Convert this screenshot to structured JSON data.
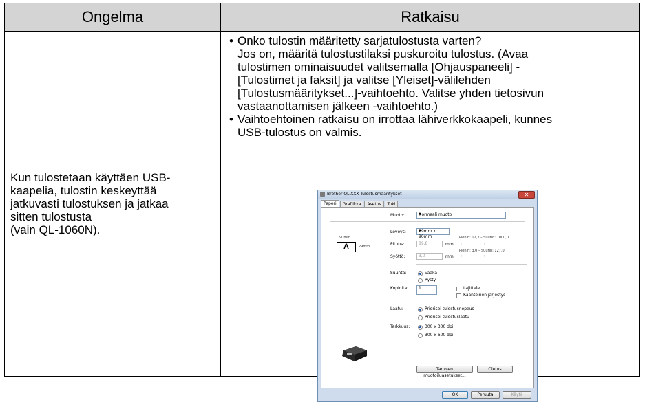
{
  "table": {
    "header_problem": "Ongelma",
    "header_solution": "Ratkaisu",
    "problem_lines": [
      "Kun tulostetaan käyttäen USB-",
      "kaapelia, tulostin keskeyttää",
      "jatkuvasti tulostuksen ja jatkaa",
      "sitten tulostusta",
      "(vain QL-1060N)."
    ],
    "bullet_symbol": "•",
    "bullet1_lines": [
      "Onko tulostin määritetty sarjatulostusta varten?",
      "Jos on, määritä tulostustilaksi puskuroitu tulostus. (Avaa",
      "tulostimen ominaisuudet valitsemalla [Ohjauspaneeli] -",
      "[Tulostimet ja faksit] ja valitse [Yleiset]-välilehden",
      "[Tulostusmääritykset...]-vaihtoehto. Valitse yhden tietosivun",
      "vastaanottamisen jälkeen -vaihtoehto.)"
    ],
    "bullet2_lines": [
      "Vaihtoehtoinen ratkaisu on irrottaa lähiverkkokaapeli, kunnes",
      "USB-tulostus on valmis."
    ]
  },
  "dialog": {
    "title": "Brother QL-XXX Tulostusmääritykset",
    "close": "✕",
    "tabs": [
      "Paperi",
      "Grafiikka",
      "Asetus",
      "Tuki"
    ],
    "muoto_label": "Muoto:",
    "muoto_value": "Normaali muoto",
    "leveys_label": "Leveys:",
    "leveys_value": "29mm x 90mm",
    "pituus_label": "Pituus:",
    "pituus_value": "89,8",
    "pituus_unit": "mm",
    "pituus_hint": "Pienin: 12,7 – Suurin: 1000,0",
    "syotto_label": "Syöttö:",
    "syotto_value": "3,0",
    "syotto_unit": "mm",
    "syotto_hint": "Pienin: 3,0 – Suurin: 127,0",
    "label_preview_w": "90mm",
    "label_preview_h": "29mm",
    "label_preview_letter": "A",
    "suunta_label": "Suunta:",
    "suunta_opt1": "Vaaka",
    "suunta_opt2": "Pysty",
    "kopioita_label": "Kopioita:",
    "kopioita_value": "1",
    "lajittele": "Lajittele",
    "kaanteinen": "Käänteinen järjestys",
    "laatu_label": "Laatu:",
    "laatu_opt1": "Priorisoi tulostusnopeus",
    "laatu_opt2": "Priorisoi tulostuslaatu",
    "tarkkuus_label": "Tarkkuus:",
    "tarkkuus_opt1": "300 x 300 dpi",
    "tarkkuus_opt2": "300 x 600 dpi",
    "btn_custom": "Tarrojen muotoiluasetukset...",
    "btn_default": "Oletus",
    "btn_ok": "OK",
    "btn_cancel": "Peruuta",
    "btn_apply": "Käytä"
  }
}
